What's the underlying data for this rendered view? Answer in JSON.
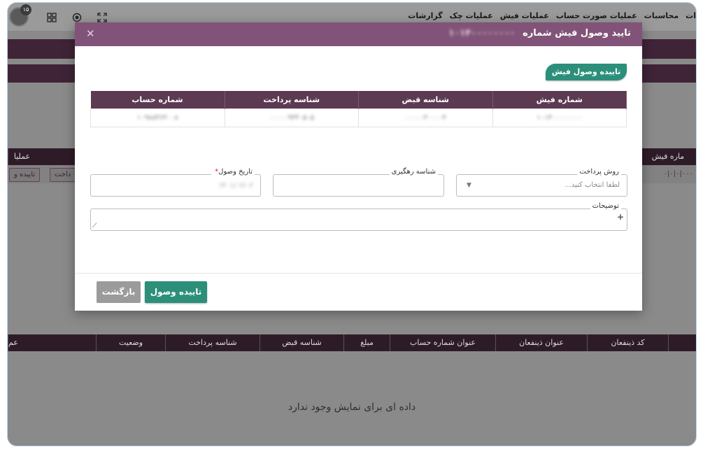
{
  "topbar": {
    "menu": [
      "ات",
      "محاسبات",
      "عملیات صورت حساب",
      "عملیات فیش",
      "عملیات چک",
      "گزارشات"
    ],
    "avatar_badge": "۱۵",
    "icons": [
      "avatar-icon",
      "apps-grid-icon",
      "record-icon",
      "fullscreen-icon"
    ]
  },
  "background": {
    "table1_headers": [
      "ماره فیش",
      "عملیا"
    ],
    "table1_row_value": "۰|۰|۰|۰۰۰",
    "row_buttons": [
      "تاییده و",
      "داخت"
    ],
    "table2_headers": [
      "کد ذینفعان",
      "عنوان ذینفعان",
      "عنوان شماره حساب",
      "مبلغ",
      "شناسه قبض",
      "شناسه پرداخت",
      "وضعیت",
      "عم"
    ],
    "empty_message": "داده ای برای نمایش وجود ندارد"
  },
  "modal": {
    "title": "تایید وصول فیش شماره",
    "title_number": "۱۰۱۴۰۰۰۰۰۰۰۰",
    "close": "✕",
    "tag": "تاییده وصول فیش",
    "table": {
      "headers": [
        "شماره فیش",
        "شناسه قبض",
        "شناسه پرداخت",
        "شماره حساب"
      ],
      "row": [
        "۱۰۱۴۰۰۰۰۰۰۰۰",
        "۰۰۰۰۰۳۰۰۰۰۳",
        "۰۰۰۰۰۹۳۴۰۵۰۵",
        "۱۰۹۸۸۴۶۳۰۰۸"
      ]
    },
    "fields": {
      "payment_method": {
        "label": "روش پرداخت",
        "placeholder": "لطفا انتخاب کنید..."
      },
      "tracking_id": {
        "label": "شناسه رهگیری",
        "value": ""
      },
      "receive_date": {
        "label": "تاریخ وصول",
        "value": "۱۴۰۱/۰۲/۰۲"
      },
      "description": {
        "label": "توضیحات",
        "value": ""
      }
    },
    "buttons": {
      "confirm": "تاییده وصول",
      "back": "بازگشت"
    }
  },
  "colors": {
    "modal_header": "#825378",
    "table_header": "#5b3a52",
    "accent_green": "#2c8f7a"
  }
}
